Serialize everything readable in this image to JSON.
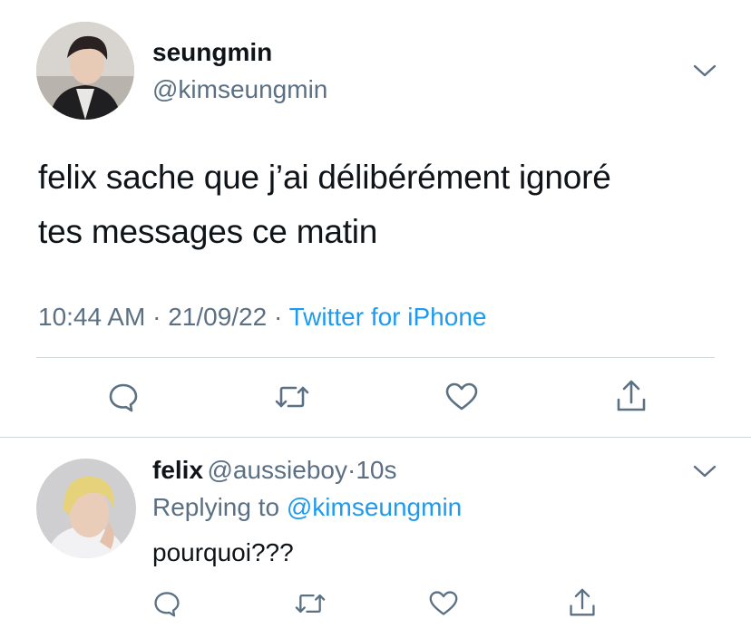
{
  "tweet": {
    "display_name": "seungmin",
    "handle": "@kimseungmin",
    "text_line1": "felix sache que j’ai délibérément ignoré",
    "text_line2": "tes messages ce matin",
    "time": "10:44 AM",
    "separator": "·",
    "date": "21/09/22",
    "source": "Twitter for iPhone",
    "icons": [
      "chevron-down-icon",
      "reply-icon",
      "retweet-icon",
      "like-icon",
      "share-icon"
    ]
  },
  "reply": {
    "display_name": "felix",
    "handle": "@aussieboy",
    "separator": "·",
    "age": "10s",
    "replying_prefix": "Replying to",
    "replying_to": "@kimseungmin",
    "text": "pourquoi???",
    "icons": [
      "chevron-down-icon",
      "reply-icon",
      "retweet-icon",
      "like-icon",
      "share-icon"
    ]
  },
  "colors": {
    "link": "#1d9bf0",
    "secondary_text": "#5b7083",
    "divider": "#cfd9de",
    "icon": "#5b7083"
  }
}
